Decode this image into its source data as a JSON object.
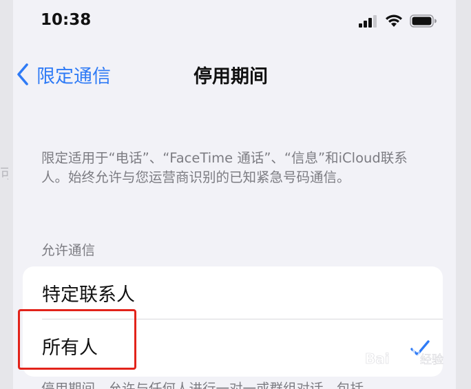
{
  "status_bar": {
    "time": "10:38",
    "signal_icon": "cellular-signal-icon",
    "wifi_icon": "wifi-icon",
    "battery_icon": "battery-icon"
  },
  "nav": {
    "back_label": "限定通信",
    "title": "停用期间"
  },
  "description": "限定适用于“电话”、“FaceTime 通话”、“信息”和iCloud联系人。始终允许与您运营商识别的已知紧急号码通信。",
  "section_header": "允许通信",
  "options": [
    {
      "label": "特定联系人",
      "selected": false
    },
    {
      "label": "所有人",
      "selected": true
    }
  ],
  "footer_text": "停用期间，允许与任何人进行一对一或群组对话，包括",
  "watermark": "Baidu经验",
  "colors": {
    "accent": "#2f7bf6",
    "highlight": "#e2231a",
    "background": "#f2f2f7"
  }
}
